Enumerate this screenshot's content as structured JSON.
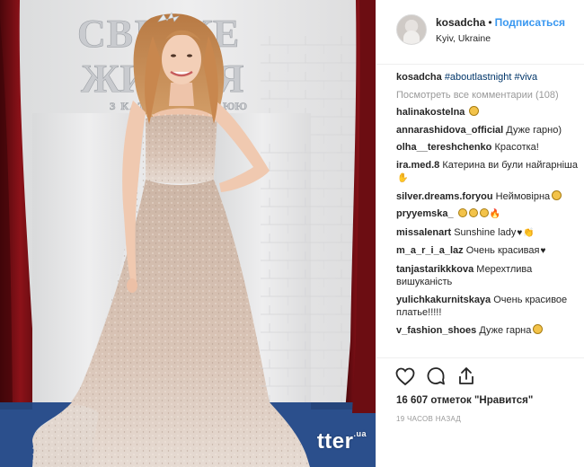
{
  "post": {
    "username": "kosadcha",
    "separator": "•",
    "follow_label": "Подписаться",
    "location": "Kyiv, Ukraine",
    "watermark": "tter",
    "watermark_suffix": ".ua",
    "backdrop_text": [
      "СВІТСЬКЕ",
      "ЖИТТЯ",
      "З КАТЕРИНОЮ"
    ]
  },
  "caption": {
    "username": "kosadcha",
    "text": "#aboutlastnight #viva"
  },
  "view_all_comments": "Посмотреть все комментарии (108)",
  "comments": [
    {
      "user": "halinakostelna",
      "text": ""
    },
    {
      "user": "annarashidova_official",
      "text": "Дуже гарно)"
    },
    {
      "user": "olha__tereshchenko",
      "text": "Красотка!"
    },
    {
      "user": "ira.med.8",
      "text": "Катерина ви були найгарніша"
    },
    {
      "user": "silver.dreams.foryou",
      "text": "Неймовірна"
    },
    {
      "user": "pryyemska_",
      "text": ""
    },
    {
      "user": "missalenart",
      "text": "Sunshine lady"
    },
    {
      "user": "m_a_r_i_a_laz",
      "text": "Очень красивая"
    },
    {
      "user": "tanjastarikkkova",
      "text": "Мерехтлива вишуканість"
    },
    {
      "user": "yulichkakurnitskaya",
      "text": "Очень красивое платье!!!!!"
    },
    {
      "user": "v_fashion_shoes",
      "text": "Дуже гарна"
    }
  ],
  "actions": {
    "like_icon": "heart-icon",
    "comment_icon": "comment-icon",
    "share_icon": "share-icon"
  },
  "likes_text": "16 607 отметок \"Нравится\"",
  "timestamp": "19 ЧАСОВ НАЗАД",
  "colors": {
    "link_blue": "#3897f0",
    "hashtag": "#003569",
    "muted": "#999999",
    "curtain_red": "#7a1016",
    "floor_blue": "#2b4f8c"
  }
}
